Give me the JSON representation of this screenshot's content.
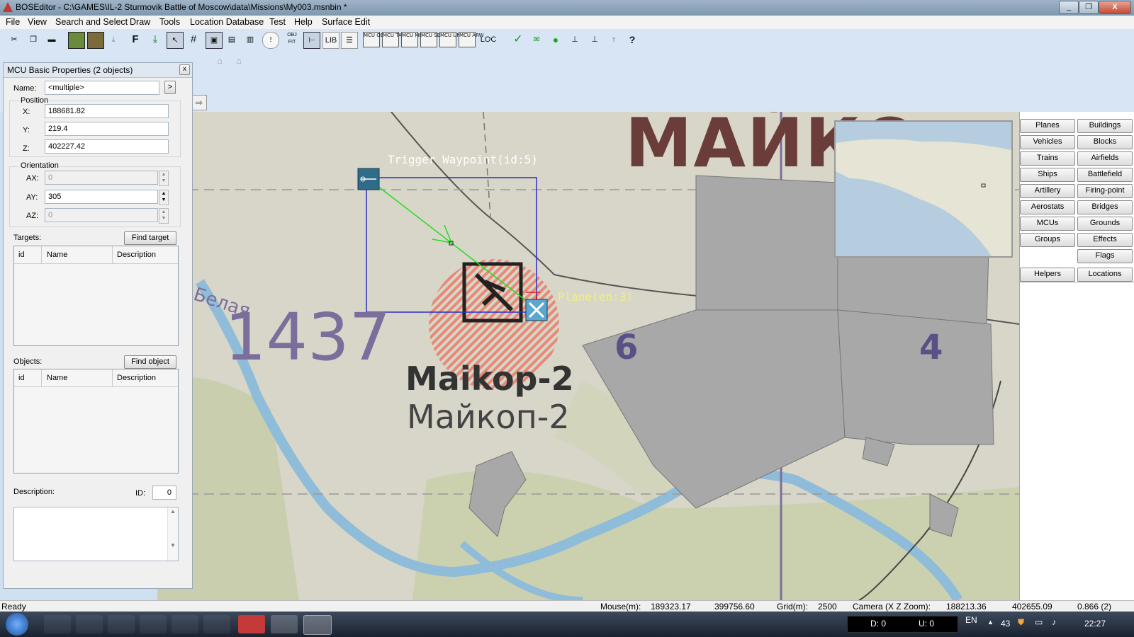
{
  "window": {
    "title": "BOSEditor - C:\\GAMES\\IL-2 Sturmovik Battle of Moscow\\data\\Missions\\My003.msnbin *",
    "controls": [
      "_",
      "❐",
      "X"
    ]
  },
  "menu": [
    "File",
    "View",
    "Search and Select",
    "Draw",
    "Tools",
    "Location Database",
    "Test",
    "Help",
    "Surface Edit"
  ],
  "toolbar": {
    "buttons": [
      "cut-icon",
      "copy-icon",
      "ruler-icon",
      "down-arrow-icon",
      "map-icon",
      "map2-icon",
      "import-icon",
      "F",
      "export-icon",
      "zoom-icon",
      "grid-icon",
      "info-icon",
      "txt-icon",
      "graph-icon",
      "flag-icon",
      "!",
      "obj-fit-icon",
      "align-icon",
      "LIB",
      "props-icon"
    ],
    "f_label": "F",
    "lib_label": "LIB",
    "loc_label": "LOC",
    "exclaim_label": "!",
    "mcu_buttons": [
      "MCU OBJ",
      "MCU TAR",
      "MCU MES",
      "MCU SEL",
      "MCU UNSE",
      "MCU ARW"
    ],
    "help_label": "?"
  },
  "properties": {
    "title": "MCU Basic Properties (2 objects)",
    "close": "x",
    "name_label": "Name:",
    "name_value": "<multiple>",
    "name_btn": ">",
    "position_label": "Position",
    "x_label": "X:",
    "x_value": "188681.82",
    "y_label": "Y:",
    "y_value": "219.4",
    "z_label": "Z:",
    "z_value": "402227.42",
    "orientation_label": "Orientation",
    "ax_label": "AX:",
    "ax_value": "0",
    "ay_label": "AY:",
    "ay_value": "305",
    "az_label": "AZ:",
    "az_value": "0",
    "targets_label": "Targets:",
    "find_target": "Find target",
    "objects_label": "Objects:",
    "find_object": "Find object",
    "columns": [
      "id",
      "Name",
      "Description"
    ],
    "description_label": "Description:",
    "id_label": "ID:",
    "id_value": "0"
  },
  "map": {
    "label_trigger": "Trigger Waypoint(id:5)",
    "label_plane": "Plane(en:3)",
    "town_big": "МАЙКО",
    "number_1437": "1437",
    "airfield_latin": "Maikop-2",
    "airfield_cyr": "Майкоп-2",
    "river_label": "Белая",
    "zone_6": "6",
    "zone_4": "4",
    "colors": {
      "selection": "#2c2cc8",
      "link": "#22dd22",
      "trigger_label": "#ffffff",
      "plane_label": "#f2f07a",
      "target_zone": "#e8826f"
    }
  },
  "right_panel": {
    "buttons": [
      [
        "Planes",
        "Buildings"
      ],
      [
        "Vehicles",
        "Blocks"
      ],
      [
        "Trains",
        "Airfields"
      ],
      [
        "Ships",
        "Battlefield"
      ],
      [
        "Artillery",
        "Firing-point"
      ],
      [
        "Aerostats",
        "Bridges"
      ],
      [
        "MCUs",
        "Grounds"
      ],
      [
        "Groups",
        "Effects"
      ],
      [
        "",
        "Flags"
      ]
    ],
    "helpers": "Helpers",
    "locations": "Locations"
  },
  "status": {
    "ready": "Ready",
    "mouse_label": "Mouse(m):",
    "mouse_x": "189323.17",
    "mouse_z": "399756.60",
    "grid_label": "Grid(m):",
    "grid_value": "2500",
    "camera_label": "Camera (X Z Zoom):",
    "camera_x": "188213.36",
    "camera_z": "402655.09",
    "camera_zoom": "0.866 (2)"
  },
  "taskbar": {
    "d_label": "D: 0",
    "u_label": "U: 0",
    "lang": "EN",
    "num": "43",
    "clock": "22:27"
  }
}
